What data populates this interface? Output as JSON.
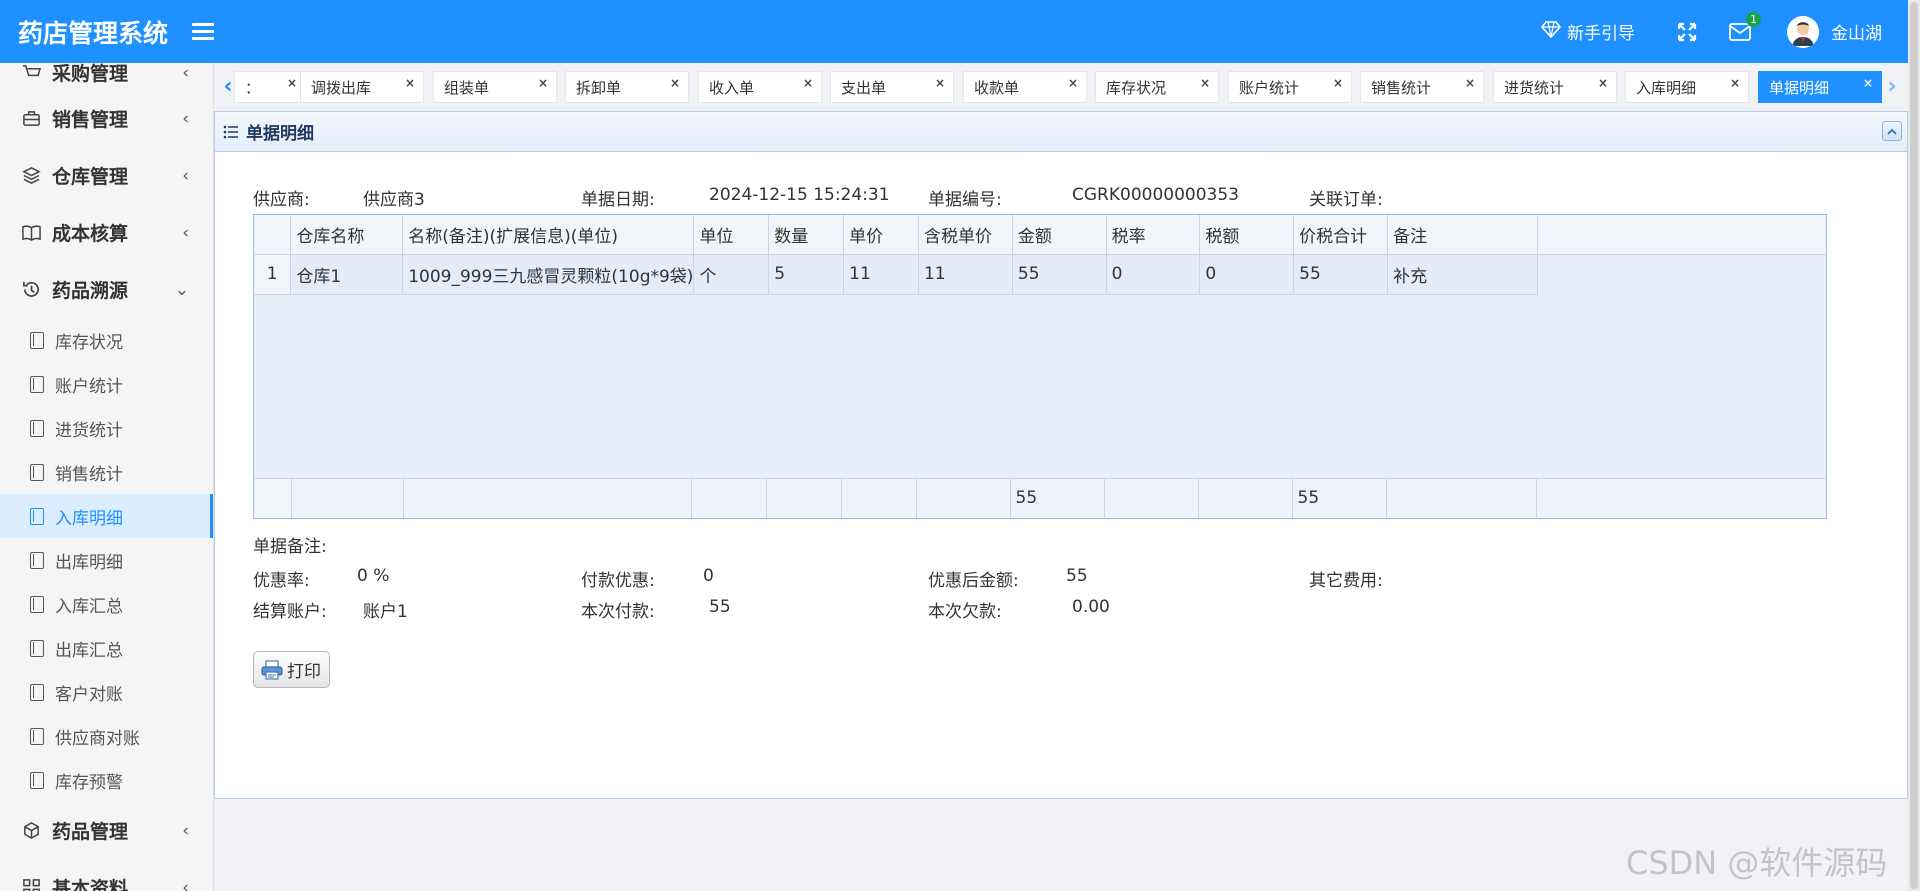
{
  "header": {
    "app_title": "药店管理系统",
    "guide_label": "新手引导",
    "mail_badge": "1",
    "user_name": "金山湖"
  },
  "sidebar": {
    "groups_top": [
      {
        "label": "采购管理",
        "icon": "cart-icon"
      },
      {
        "label": "销售管理",
        "icon": "briefcase-icon"
      },
      {
        "label": "仓库管理",
        "icon": "layers-icon"
      },
      {
        "label": "成本核算",
        "icon": "book-icon"
      },
      {
        "label": "药品溯源",
        "icon": "history-icon"
      }
    ],
    "sub_items": [
      "库存状况",
      "账户统计",
      "进货统计",
      "销售统计",
      "入库明细",
      "出库明细",
      "入库汇总",
      "出库汇总",
      "客户对账",
      "供应商对账",
      "库存预警"
    ],
    "active_sub": "入库明细",
    "groups_bottom": [
      {
        "label": "药品管理",
        "icon": "cube-icon"
      },
      {
        "label": "基本资料",
        "icon": "grid-icon"
      }
    ]
  },
  "tabs": [
    "：",
    "调拨出库",
    "组装单",
    "拆卸单",
    "收入单",
    "支出单",
    "收款单",
    "库存状况",
    "账户统计",
    "销售统计",
    "进货统计",
    "入库明细",
    "单据明细"
  ],
  "active_tab": "单据明细",
  "panel": {
    "title": "单据明细",
    "supplier_label": "供应商:",
    "supplier_value": "供应商3",
    "date_label": "单据日期:",
    "date_value": "2024-12-15 15:24:31",
    "number_label": "单据编号:",
    "number_value": "CGRK00000000353",
    "order_label": "关联订单:",
    "order_value": ""
  },
  "table": {
    "columns": [
      "",
      "仓库名称",
      "名称(备注)(扩展信息)(单位)",
      "单位",
      "数量",
      "单价",
      "含税单价",
      "金额",
      "税率",
      "税额",
      "价税合计",
      "备注",
      ""
    ],
    "rows": [
      [
        "1",
        "仓库1",
        "1009_999三九感冒灵颗粒(10g*9袋)",
        "个",
        "5",
        "11",
        "11",
        "55",
        "0",
        "0",
        "55",
        "补充",
        ""
      ]
    ],
    "footer": [
      "",
      "",
      "",
      "",
      "",
      "",
      "",
      "55",
      "",
      "",
      "55",
      "",
      ""
    ]
  },
  "summary": {
    "remark_label": "单据备注:",
    "remark_value": "",
    "discount_rate_label": "优惠率:",
    "discount_rate_value": "0 %",
    "payment_discount_label": "付款优惠:",
    "payment_discount_value": "0",
    "after_discount_label": "优惠后金额:",
    "after_discount_value": "55",
    "other_fee_label": "其它费用:",
    "other_fee_value": "",
    "account_label": "结算账户:",
    "account_value": "账户1",
    "paid_label": "本次付款:",
    "paid_value": "55",
    "owed_label": "本次欠款:",
    "owed_value": "0.00"
  },
  "print_label": "打印",
  "watermark": "CSDN @软件源码"
}
